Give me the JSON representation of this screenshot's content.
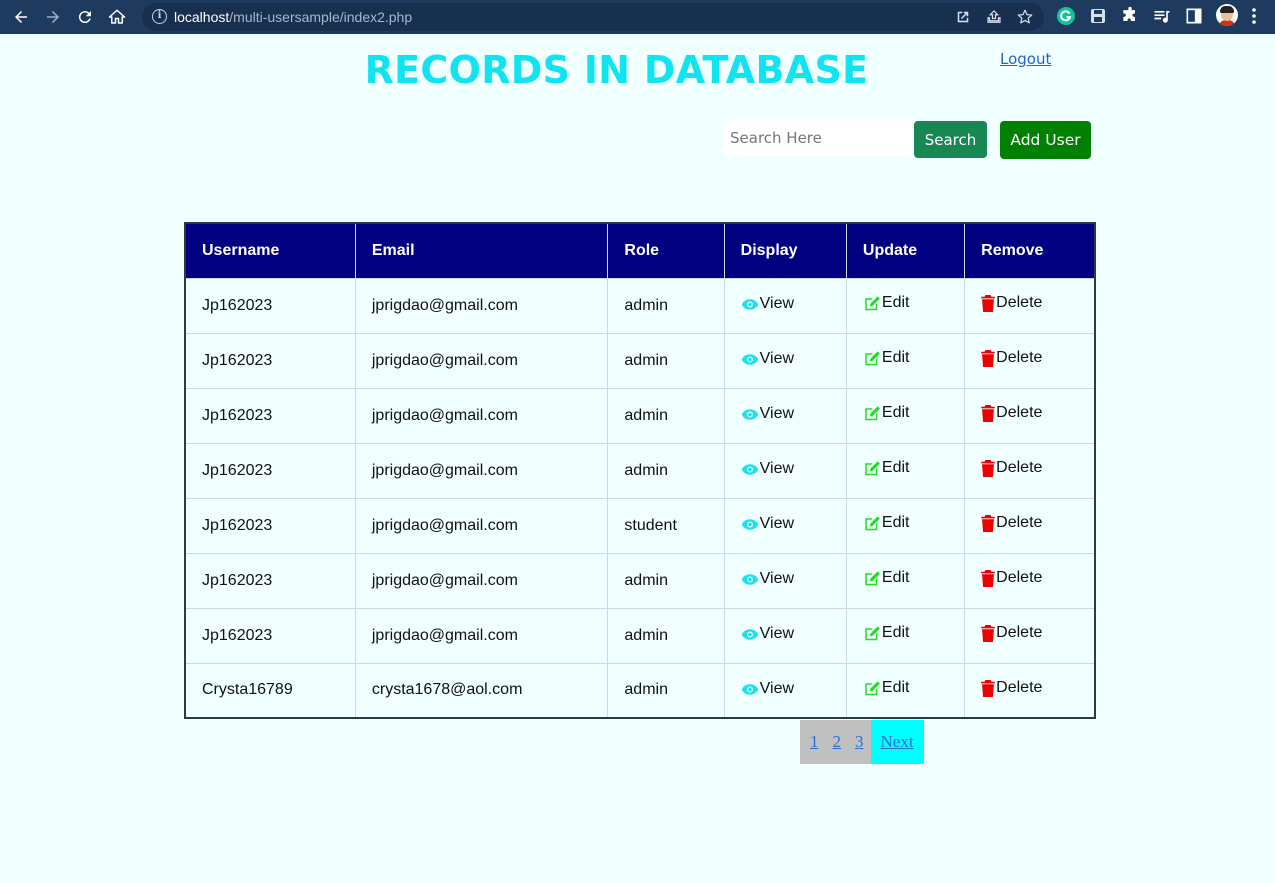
{
  "browser": {
    "url_host": "localhost",
    "url_path": "/multi-usersample/index2.php"
  },
  "page": {
    "title": "RECORDS IN DATABASE",
    "logout_label": "Logout"
  },
  "search": {
    "placeholder": "Search Here",
    "value": "",
    "button_label": "Search"
  },
  "add_user_label": "Add User",
  "table": {
    "headers": [
      "Username",
      "Email",
      "Role",
      "Display",
      "Update",
      "Remove"
    ],
    "rows": [
      {
        "username": "Jp162023",
        "email": "jprigdao@gmail.com",
        "role": "admin",
        "view": "View",
        "edit": "Edit",
        "delete": "Delete"
      },
      {
        "username": "Jp162023",
        "email": "jprigdao@gmail.com",
        "role": "admin",
        "view": "View",
        "edit": "Edit",
        "delete": "Delete"
      },
      {
        "username": "Jp162023",
        "email": "jprigdao@gmail.com",
        "role": "admin",
        "view": "View",
        "edit": "Edit",
        "delete": "Delete"
      },
      {
        "username": "Jp162023",
        "email": "jprigdao@gmail.com",
        "role": "admin",
        "view": "View",
        "edit": "Edit",
        "delete": "Delete"
      },
      {
        "username": "Jp162023",
        "email": "jprigdao@gmail.com",
        "role": "student",
        "view": "View",
        "edit": "Edit",
        "delete": "Delete"
      },
      {
        "username": "Jp162023",
        "email": "jprigdao@gmail.com",
        "role": "admin",
        "view": "View",
        "edit": "Edit",
        "delete": "Delete"
      },
      {
        "username": "Jp162023",
        "email": "jprigdao@gmail.com",
        "role": "admin",
        "view": "View",
        "edit": "Edit",
        "delete": "Delete"
      },
      {
        "username": "Crysta16789",
        "email": "crysta1678@aol.com",
        "role": "admin",
        "view": "View",
        "edit": "Edit",
        "delete": "Delete"
      }
    ]
  },
  "pagination": {
    "pages": [
      "1",
      "2",
      "3"
    ],
    "next_label": "Next"
  },
  "colors": {
    "title": "#12e3f0",
    "table_header_bg": "#000080",
    "view_icon": "#1ee0f0",
    "edit_icon": "#22dd22",
    "delete_icon": "#ee0000",
    "search_button": "#198754",
    "add_button": "#008000",
    "pager_bg": "#c0c0c0",
    "pager_next_bg": "#00ffff"
  },
  "icons": {
    "view": "eye-icon",
    "edit": "edit-square-icon",
    "delete": "trash-icon"
  }
}
